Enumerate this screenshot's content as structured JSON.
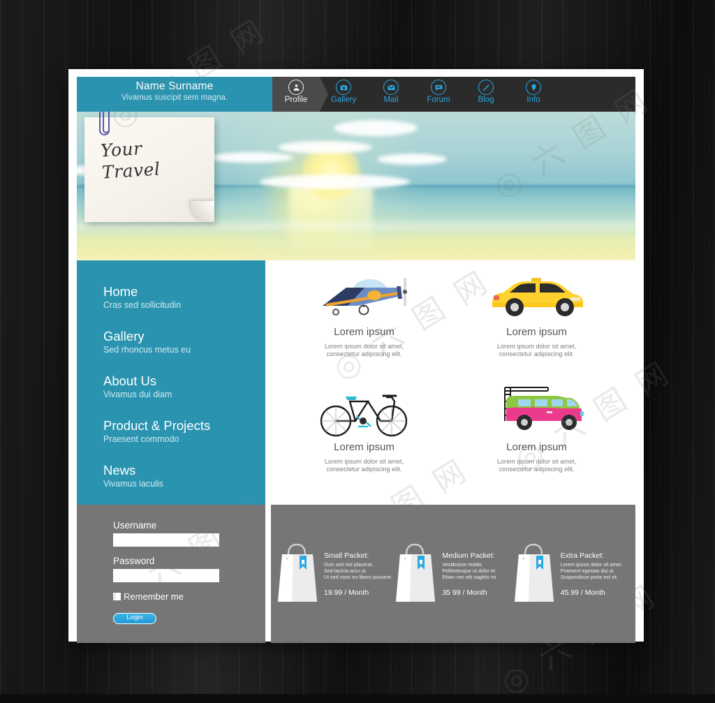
{
  "brand": {
    "name": "Name Surname",
    "tagline": "Vivamus suscipit sem magna."
  },
  "nav": {
    "items": [
      {
        "label": "Profile",
        "icon": "person-icon",
        "active": true
      },
      {
        "label": "Gallery",
        "icon": "camera-icon",
        "active": false
      },
      {
        "label": "Mail",
        "icon": "envelope-icon",
        "active": false
      },
      {
        "label": "Forum",
        "icon": "speech-bubble-icon",
        "active": false
      },
      {
        "label": "Blog",
        "icon": "pencil-icon",
        "active": false
      },
      {
        "label": "Info",
        "icon": "location-pin-icon",
        "active": false
      }
    ]
  },
  "banner": {
    "note_line1": "Your",
    "note_line2": "Travel",
    "scene": "sunset-over-sea"
  },
  "sidebar": {
    "items": [
      {
        "title": "Home",
        "subtitle": "Cras sed sollicitudin"
      },
      {
        "title": "Gallery",
        "subtitle": "Sed rhoncus metus eu"
      },
      {
        "title": "About Us",
        "subtitle": "Vivamus dui diam"
      },
      {
        "title": "Product & Projects",
        "subtitle": "Praesent commodo"
      },
      {
        "title": "News",
        "subtitle": "Vivamus iaculis"
      }
    ]
  },
  "cards": [
    {
      "icon": "airplane-icon",
      "title": "Lorem ipsum",
      "desc": "Lorem ipsum dolor sit amet, consectetur adipiscing elit."
    },
    {
      "icon": "taxi-icon",
      "title": "Lorem ipsum",
      "desc": "Lorem ipsum dolor sit amet, consectetur adipiscing elit."
    },
    {
      "icon": "bicycle-icon",
      "title": "Lorem ipsum",
      "desc": "Lorem ipsum dolor sit amet, consectetur adipiscing elit."
    },
    {
      "icon": "van-icon",
      "title": "Lorem ipsum",
      "desc": "Lorem ipsum dolor sit amet, consectetur adipiscing elit."
    }
  ],
  "login": {
    "username_label": "Username",
    "username_value": "",
    "password_label": "Password",
    "password_value": "",
    "remember_label": "Remember me",
    "remember_checked": false,
    "submit_label": "Login"
  },
  "packets": [
    {
      "name": "Small Packet:",
      "lines": "Duis sed nisl placerat,\nSed lacinia arcu ut.\nUt sed nunc eu libero posuere.",
      "price": "19.99 / Month"
    },
    {
      "name": "Medium Packet:",
      "lines": "Vestibulum mattis.\nPellentesque ut dolor et.\nEtiam nec elit sagittis mi.",
      "price": "35 99 / Month"
    },
    {
      "name": "Extra Packet:",
      "lines": "Lorem ipsum dolor sit amet.\nPraesent egestas dui ut.\nSuspendisse porta est sit.",
      "price": "45.99 / Month"
    }
  ],
  "colors": {
    "brand_teal": "#2a94b0",
    "nav_dark": "#2b2b2b",
    "nav_active": "#4a4a4a",
    "accent_blue": "#29a8e0",
    "panel_gray": "#767676",
    "page_white": "#ffffff"
  }
}
